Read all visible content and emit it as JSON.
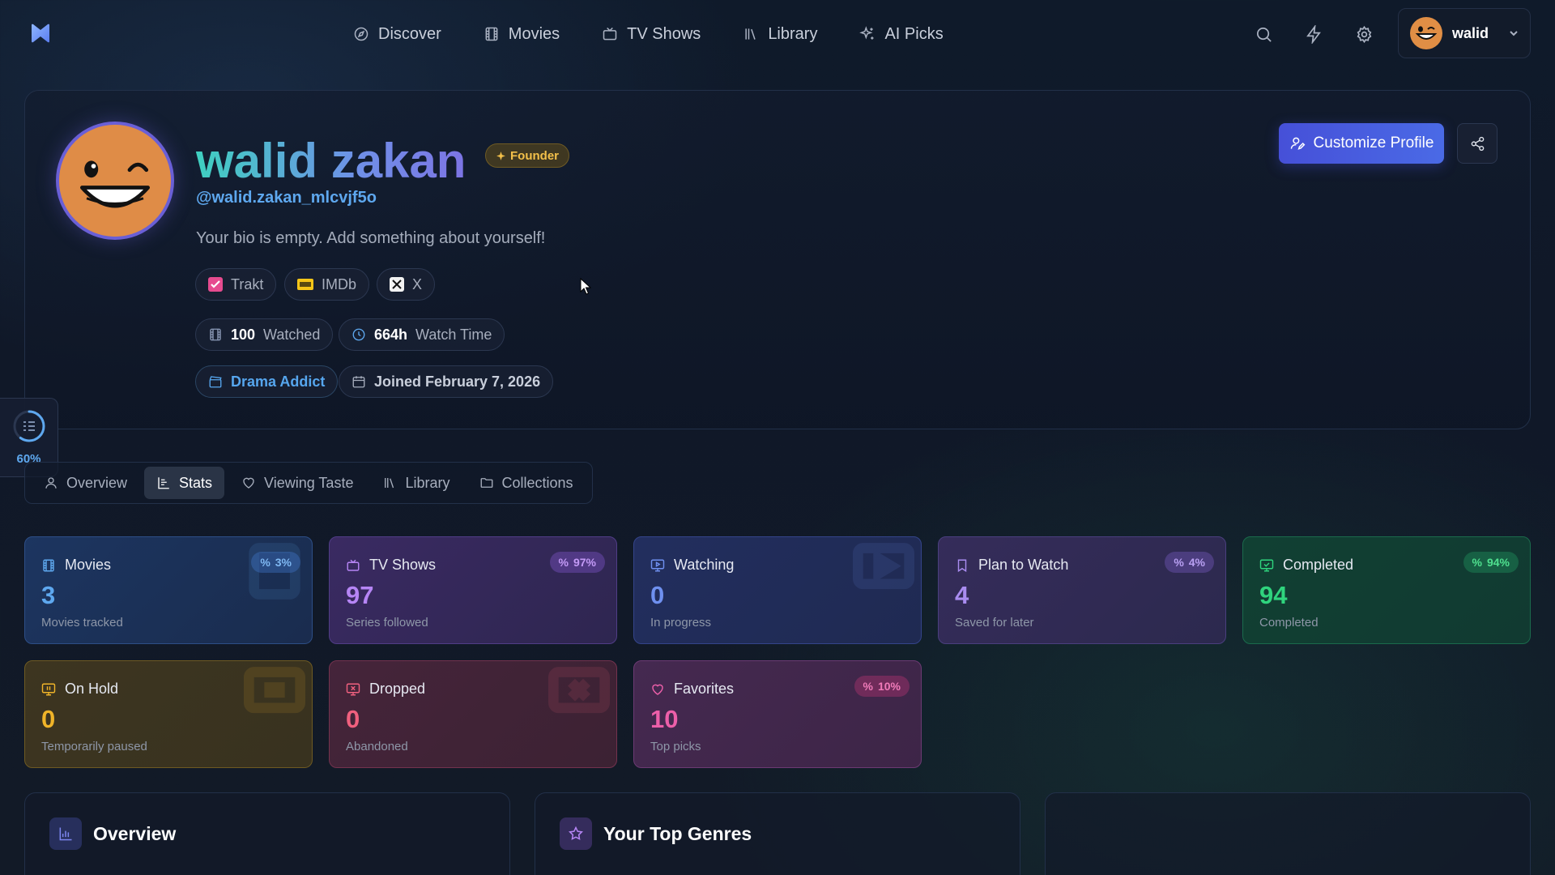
{
  "nav": {
    "logo_icon": "brand-logo-icon",
    "items": [
      {
        "label": "Discover",
        "icon": "compass-icon"
      },
      {
        "label": "Movies",
        "icon": "film-icon"
      },
      {
        "label": "TV Shows",
        "icon": "tv-icon"
      },
      {
        "label": "Library",
        "icon": "library-icon"
      },
      {
        "label": "AI Picks",
        "icon": "sparkles-icon"
      }
    ],
    "icons": [
      "search-icon",
      "zap-icon",
      "gear-icon"
    ],
    "user": {
      "name": "walid"
    }
  },
  "profile": {
    "name": "walid zakan",
    "badge": "Founder",
    "handle": "@walid.zakan_mlcvjf5o",
    "bio": "Your bio is empty. Add something about yourself!",
    "links": [
      "Trakt",
      "IMDb",
      "X"
    ],
    "stats": {
      "watched_value": "100",
      "watched_label": "Watched",
      "time_value": "664h",
      "time_label": "Watch Time"
    },
    "persona": "Drama Addict",
    "joined": "Joined February 7, 2026",
    "customize_label": "Customize Profile"
  },
  "progress": {
    "percent": "60%",
    "value": 0.6
  },
  "tabs": [
    {
      "label": "Overview",
      "active": false
    },
    {
      "label": "Stats",
      "active": true
    },
    {
      "label": "Viewing Taste",
      "active": false
    },
    {
      "label": "Library",
      "active": false
    },
    {
      "label": "Collections",
      "active": false
    }
  ],
  "stat_cards": [
    {
      "title": "Movies",
      "value": "3",
      "sub": "Movies tracked",
      "pct": "3%",
      "color": "#5ea8ef"
    },
    {
      "title": "TV Shows",
      "value": "97",
      "sub": "Series followed",
      "pct": "97%",
      "color": "#b685f5"
    },
    {
      "title": "Watching",
      "value": "0",
      "sub": "In progress",
      "pct": "",
      "color": "#6f90ef"
    },
    {
      "title": "Plan to Watch",
      "value": "4",
      "sub": "Saved for later",
      "pct": "4%",
      "color": "#a98cf0"
    },
    {
      "title": "Completed",
      "value": "94",
      "sub": "Completed",
      "pct": "94%",
      "color": "#2fd47d"
    },
    {
      "title": "On Hold",
      "value": "0",
      "sub": "Temporarily paused",
      "pct": "",
      "color": "#f0b429"
    },
    {
      "title": "Dropped",
      "value": "0",
      "sub": "Abandoned",
      "pct": "",
      "color": "#f0607e"
    },
    {
      "title": "Favorites",
      "value": "10",
      "sub": "Top picks",
      "pct": "10%",
      "color": "#ec5fa9"
    }
  ],
  "panels": [
    {
      "title": "Overview",
      "icon": "bar-chart-icon"
    },
    {
      "title": "Your Top Genres",
      "icon": "star-icon"
    },
    {
      "title": "",
      "icon": ""
    }
  ]
}
